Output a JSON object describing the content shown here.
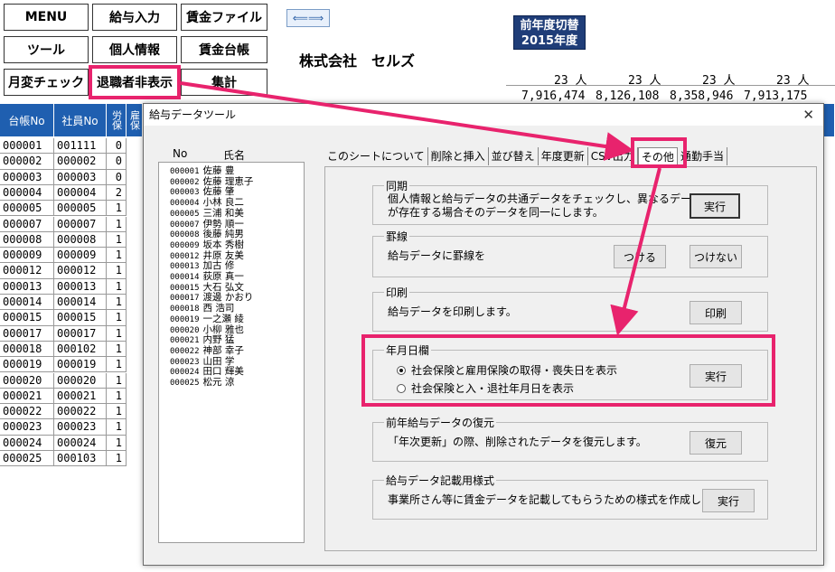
{
  "menu_buttons": [
    "MENU",
    "給与入力",
    "賃金ファイル",
    "ツール",
    "個人情報",
    "賃金台帳",
    "月変チェック",
    "退職者非表示",
    "集計"
  ],
  "arrow_button": "⟸⟹",
  "prev_year": {
    "line1": "前年度切替",
    "line2": "2015年度"
  },
  "company": "株式会社　セルズ",
  "counts": [
    "23 人",
    "23 人",
    "23 人",
    "23 人"
  ],
  "amounts": [
    "7,916,474",
    "8,126,108",
    "8,358,946",
    "7,913,175"
  ],
  "sheet": {
    "headers": [
      "台帳No",
      "社員No",
      "労保",
      "雇保"
    ],
    "rows": [
      [
        "000001",
        "001111",
        "0"
      ],
      [
        "000002",
        "000002",
        "0"
      ],
      [
        "000003",
        "000003",
        "0"
      ],
      [
        "000004",
        "000004",
        "2"
      ],
      [
        "000005",
        "000005",
        "1"
      ],
      [
        "000007",
        "000007",
        "1"
      ],
      [
        "000008",
        "000008",
        "1"
      ],
      [
        "000009",
        "000009",
        "1"
      ],
      [
        "000012",
        "000012",
        "1"
      ],
      [
        "000013",
        "000013",
        "1"
      ],
      [
        "000014",
        "000014",
        "1"
      ],
      [
        "000015",
        "000015",
        "1"
      ],
      [
        "000017",
        "000017",
        "1"
      ],
      [
        "000018",
        "000102",
        "1"
      ],
      [
        "000019",
        "000019",
        "1"
      ],
      [
        "000020",
        "000020",
        "1"
      ],
      [
        "000021",
        "000021",
        "1"
      ],
      [
        "000022",
        "000022",
        "1"
      ],
      [
        "000023",
        "000023",
        "1"
      ],
      [
        "000024",
        "000024",
        "1"
      ],
      [
        "000025",
        "000103",
        "1"
      ]
    ]
  },
  "dialog": {
    "title": "給与データツール",
    "close": "✕",
    "list_headers": {
      "no": "No",
      "name": "氏名"
    },
    "employees": [
      {
        "no": "000001",
        "name": "佐藤 豊"
      },
      {
        "no": "000002",
        "name": "佐藤 理恵子"
      },
      {
        "no": "000003",
        "name": "佐藤 肇"
      },
      {
        "no": "000004",
        "name": "小林 良二"
      },
      {
        "no": "000005",
        "name": "三浦 和美"
      },
      {
        "no": "000007",
        "name": "伊勢 順一"
      },
      {
        "no": "000008",
        "name": "後藤 純男"
      },
      {
        "no": "000009",
        "name": "坂本 秀樹"
      },
      {
        "no": "000012",
        "name": "井原 友美"
      },
      {
        "no": "000013",
        "name": "加古 修"
      },
      {
        "no": "000014",
        "name": "荻原 真一"
      },
      {
        "no": "000015",
        "name": "大石 弘文"
      },
      {
        "no": "000017",
        "name": "渡邊 かおり"
      },
      {
        "no": "000018",
        "name": "西 浩司"
      },
      {
        "no": "000019",
        "name": "一之瀬 綾"
      },
      {
        "no": "000020",
        "name": "小柳 雅也"
      },
      {
        "no": "000021",
        "name": "内野 猛"
      },
      {
        "no": "000022",
        "name": "神部 幸子"
      },
      {
        "no": "000023",
        "name": "山田 学"
      },
      {
        "no": "000024",
        "name": "田口 輝美"
      },
      {
        "no": "000025",
        "name": "松元 涼"
      }
    ],
    "tabs": [
      "このシートについて",
      "削除と挿入",
      "並び替え",
      "年度更新",
      "CSV出力",
      "その他",
      "通勤手当"
    ],
    "groups": {
      "sync": {
        "title": "同期",
        "desc1": "個人情報と給与データの共通データをチェックし、異なるデータ",
        "desc2": "が存在する場合そのデータを同一にします。",
        "btn": "実行"
      },
      "rule": {
        "title": "罫線",
        "desc": "給与データに罫線を",
        "btn1": "つける",
        "btn2": "つけない"
      },
      "print": {
        "title": "印刷",
        "desc": "給与データを印刷します。",
        "btn": "印刷"
      },
      "date": {
        "title": "年月日欄",
        "opt1": "社会保険と雇用保険の取得・喪失日を表示",
        "opt2": "社会保険と入・退社年月日を表示",
        "btn": "実行"
      },
      "restore": {
        "title": "前年給与データの復元",
        "desc": "「年次更新」の際、削除されたデータを復元します。",
        "btn": "復元"
      },
      "format": {
        "title": "給与データ記載用様式",
        "desc": "事業所さん等に賃金データを記載してもらうための様式を作成します。",
        "btn": "実行"
      }
    }
  },
  "colors": {
    "highlight": "#e8236d",
    "header_blue": "#1f5fb0",
    "dark_blue": "#1f3d78"
  }
}
